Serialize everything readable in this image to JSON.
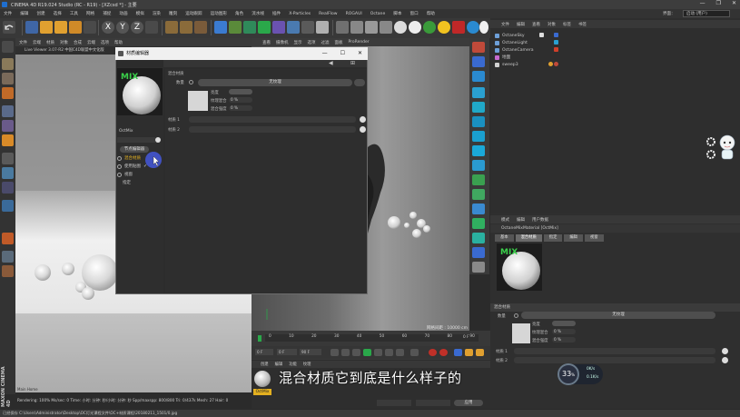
{
  "window": {
    "title": "CINEMA 4D R19.024 Studio (RC - R19) - [XZcsd *] - 主要",
    "controls": [
      "—",
      "❐",
      "✕"
    ]
  },
  "menubar": {
    "items": [
      "文件",
      "编辑",
      "创建",
      "选择",
      "工具",
      "网格",
      "捕捉",
      "动画",
      "模拟",
      "渲染",
      "雕刻",
      "运动跟踪",
      "运动图形",
      "角色",
      "流水线",
      "插件",
      "X-Particles",
      "RealFlow",
      "ROGAUI",
      "Octane",
      "脚本",
      "窗口",
      "帮助"
    ],
    "layout_label": "界面：",
    "layout_value": "启动 (用户)"
  },
  "viewport_left": {
    "menu": [
      "文件",
      "云端",
      "材质",
      "对象",
      "合成",
      "云端",
      "选项",
      "帮助"
    ],
    "window_title": "Live Viewer 3.07-R2 中国C4D联盟中文化版",
    "watermark": "Main  Home"
  },
  "viewport_right": {
    "menu": [
      "查看",
      "摄像机",
      "显示",
      "选项",
      "过滤",
      "面板",
      "ProRender"
    ],
    "hud_label": "网格间距 : 10000 cm"
  },
  "status": {
    "render_info": "Rendering: 100%   Ms/sec: 0   Time: 小时: 分钟: 秒/小时: 分钟: 秒   Spp/maxspp: 800/800   Tri: 0/437k   Mesh: 27   Hair: 0"
  },
  "object_manager": {
    "menu": [
      "文件",
      "编辑",
      "查看",
      "对象",
      "标签",
      "书签"
    ],
    "objects": [
      {
        "name": "OctaneSky",
        "color": "#6d9fd8"
      },
      {
        "name": "OctaneLight",
        "color": "#6d9fd8"
      },
      {
        "name": "OctaneCamera",
        "color": "#6d9fd8"
      },
      {
        "name": "地面",
        "color": "#c86ad0"
      },
      {
        "name": "sweep3",
        "color": "#d0d0d0"
      }
    ]
  },
  "material_editor": {
    "title": "材质编辑器",
    "controls": [
      "—",
      "☐",
      "✕"
    ],
    "material_name": "OctMix",
    "thumb_text": "MIX",
    "left_button": "节点编辑器",
    "left_items": [
      "混合材质",
      "使用贴图",
      "视窗",
      "指定"
    ],
    "section_title": "混合材质",
    "amount_label": "数量",
    "texture_button": "无纹理",
    "params": [
      {
        "label": "亮度",
        "value": ""
      },
      {
        "label": "纹理混合",
        "value": "0 %"
      },
      {
        "label": "混合强度",
        "value": "0 %"
      }
    ],
    "slots": [
      {
        "label": "材质 1"
      },
      {
        "label": "材质 2"
      }
    ]
  },
  "attribute_manager": {
    "menu": [
      "模式",
      "编辑",
      "用户数据"
    ],
    "title": "OctaneMixMaterial [OctMix]",
    "tabs": [
      "基本",
      "混合材质",
      "指定",
      "编辑",
      "视窗"
    ],
    "selected_tab": 1,
    "thumb_text": "MIX",
    "section_title": "混合材质",
    "amount_label": "数量",
    "texture_button": "无纹理",
    "params": [
      {
        "label": "亮度",
        "value": ""
      },
      {
        "label": "纹理混合",
        "value": "0 %"
      },
      {
        "label": "混合强度",
        "value": "0 %"
      }
    ],
    "slots": [
      {
        "label": "材质 1"
      },
      {
        "label": "材质 2"
      }
    ]
  },
  "timeline": {
    "ticks": [
      "0",
      "10",
      "20",
      "30",
      "40",
      "50",
      "60",
      "70",
      "80",
      "90"
    ],
    "end_frame": "0 F",
    "start_field": "0 F",
    "current_field": "0 F",
    "end_field": "90 F",
    "max_field": "90 F"
  },
  "material_manager": {
    "menu": [
      "创建",
      "编辑",
      "功能",
      "纹理"
    ],
    "material_label": "OctMix"
  },
  "subtitle": {
    "text": "混合材质它到底是什么样子的"
  },
  "coords": {
    "apply_button": "应用"
  },
  "perf": {
    "percent": "33",
    "up": "0K/s",
    "down": "0.1K/s"
  },
  "path": {
    "text": "已经保存 C:\\Users\\Administrator\\Desktop\\OC灯光课程文件\\OC+材质课程\\20180211_1501/0.jpg"
  },
  "logo": {
    "text": "MAXON CINEMA 4D"
  },
  "colors": {
    "accent": "#e3b020",
    "selection": "#3c6ea0",
    "green": "#2aa84a"
  }
}
